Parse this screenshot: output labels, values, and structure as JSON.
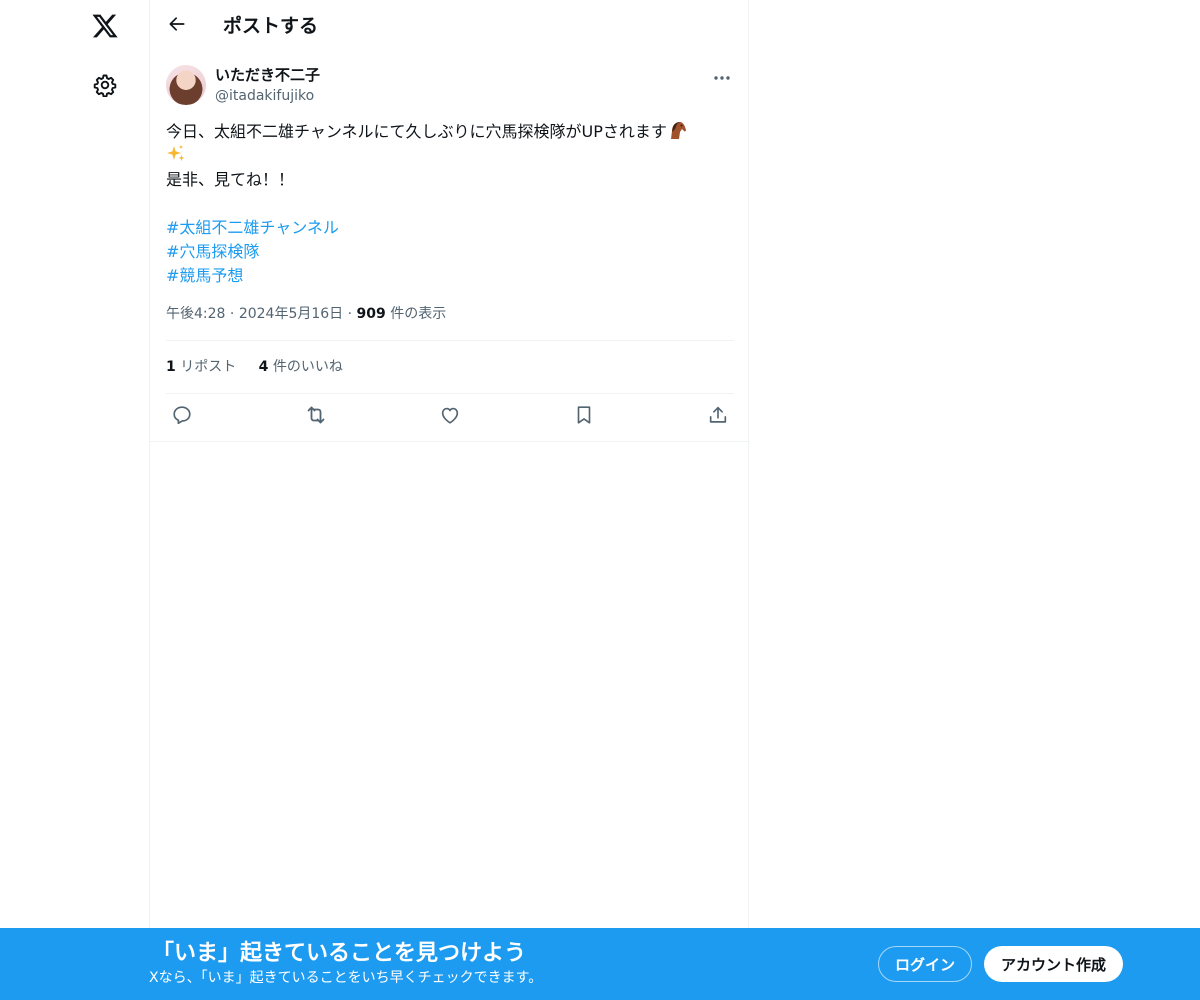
{
  "nav": {
    "logo_icon": "x-logo-icon",
    "settings_icon": "gear-icon"
  },
  "header": {
    "back_icon": "arrow-left-icon",
    "title": "ポストする"
  },
  "post": {
    "author": {
      "name": "いただき不二子",
      "handle": "@itadakifujiko"
    },
    "more_icon": "more-dots-icon",
    "text_line1": "今日、太組不二雄チャンネルにて久しぶりに穴馬探検隊がUPされます",
    "text_line1_emoji": "horse-icon",
    "text_line2_emoji": "sparkles-icon",
    "text_line3": "是非、見てね！！",
    "hashtags": [
      "#太組不二雄チャンネル",
      "#穴馬探検隊",
      "#競馬予想"
    ],
    "time": "午後4:28",
    "separator": "·",
    "date": "2024年5月16日",
    "views_count": "909",
    "views_label": "件の表示",
    "reposts_count": "1",
    "reposts_label": "リポスト",
    "likes_count": "4",
    "likes_label": "件のいいね",
    "actions": [
      "reply-icon",
      "repost-icon",
      "like-icon",
      "bookmark-icon",
      "share-icon"
    ]
  },
  "banner": {
    "title": "「いま」起きていることを見つけよう",
    "subtitle": "Xなら、「いま」起きていることをいち早くチェックできます。",
    "login_label": "ログイン",
    "signup_label": "アカウント作成"
  },
  "colors": {
    "accent": "#1d9bf0",
    "text": "#0f1419",
    "secondary_text": "#536471",
    "border": "#eff3f4"
  }
}
